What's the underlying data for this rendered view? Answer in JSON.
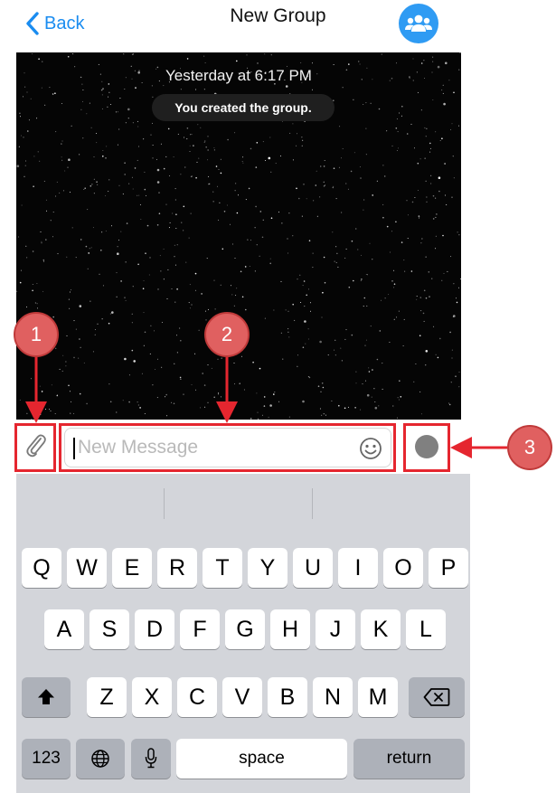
{
  "header": {
    "back_label": "Back",
    "title": "New Group",
    "group_icon": "group-icon"
  },
  "chat": {
    "timestamp": "Yesterday at 6:17 PM",
    "system_message": "You created the group."
  },
  "composer": {
    "attach_icon": "paperclip-icon",
    "placeholder": "New Message",
    "emoji_icon": "emoji-icon",
    "send_icon": "send-dot-icon"
  },
  "annotations": [
    "1",
    "2",
    "3"
  ],
  "keyboard": {
    "row1": [
      "Q",
      "W",
      "E",
      "R",
      "T",
      "Y",
      "U",
      "I",
      "O",
      "P"
    ],
    "row2": [
      "A",
      "S",
      "D",
      "F",
      "G",
      "H",
      "J",
      "K",
      "L"
    ],
    "row3": [
      "Z",
      "X",
      "C",
      "V",
      "B",
      "N",
      "M"
    ],
    "numbers_label": "123",
    "space_label": "space",
    "return_label": "return"
  },
  "colors": {
    "accent": "#1a8cf0",
    "annotation_red": "#e5262f",
    "annotation_fill": "#e06060"
  }
}
